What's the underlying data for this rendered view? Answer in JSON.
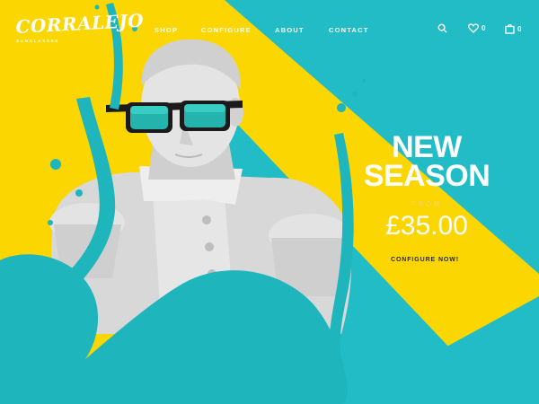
{
  "brand": {
    "name": "CORRALEJO",
    "tagline": "SUNGLASSES"
  },
  "nav": {
    "items": [
      "SHOP",
      "CONFIGURE",
      "ABOUT",
      "CONTACT"
    ]
  },
  "header_icons": {
    "search": "search-icon",
    "wishlist": {
      "icon": "heart-icon",
      "count": "0"
    },
    "cart": {
      "icon": "bag-icon",
      "count": "0"
    }
  },
  "hero": {
    "title_line1": "NEW",
    "title_line2": "SEASON",
    "from_label": "FROM",
    "price": "£35.00",
    "cta_label": "CONFIGURE NOW!"
  },
  "colors": {
    "teal": "#22bcc6",
    "yellow": "#fcd600",
    "paint": "#1eb5bd",
    "white": "#ffffff"
  }
}
